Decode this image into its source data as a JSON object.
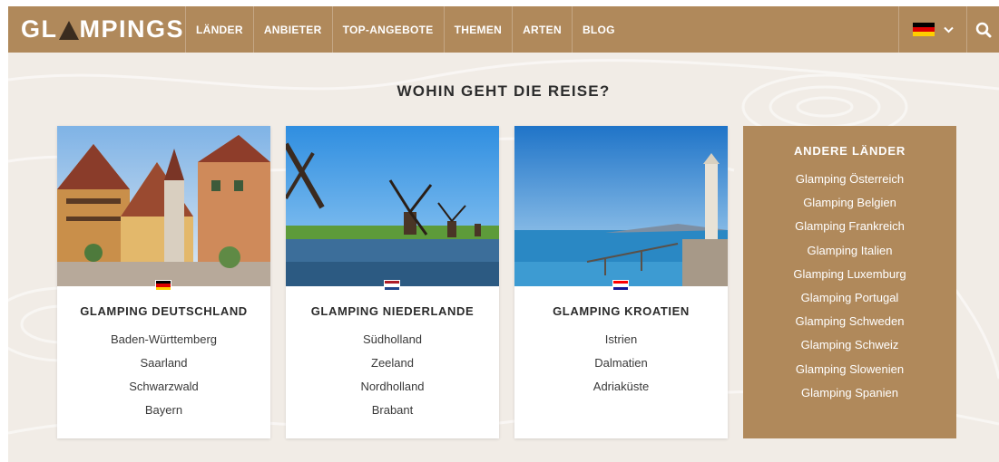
{
  "nav": {
    "logo_prefix": "GL",
    "logo_suffix": "MPINGS",
    "items": [
      "LÄNDER",
      "ANBIETER",
      "TOP-ANGEBOTE",
      "THEMEN",
      "ARTEN",
      "BLOG"
    ],
    "language_icon": "germany-flag-icon",
    "dropdown_icon": "chevron-down-icon",
    "search_icon": "search-icon"
  },
  "section_title": "WOHIN GEHT DIE REISE?",
  "cards": [
    {
      "title": "GLAMPING DEUTSCHLAND",
      "flag": "germany-flag-icon",
      "regions": [
        "Baden-Württemberg",
        "Saarland",
        "Schwarzwald",
        "Bayern"
      ]
    },
    {
      "title": "GLAMPING NIEDERLANDE",
      "flag": "netherlands-flag-icon",
      "regions": [
        "Südholland",
        "Zeeland",
        "Nordholland",
        "Brabant"
      ]
    },
    {
      "title": "GLAMPING KROATIEN",
      "flag": "croatia-flag-icon",
      "regions": [
        "Istrien",
        "Dalmatien",
        "Adriaküste"
      ]
    }
  ],
  "other_countries": {
    "title": "ANDERE LÄNDER",
    "items": [
      "Glamping Österreich",
      "Glamping Belgien",
      "Glamping Frankreich",
      "Glamping Italien",
      "Glamping Luxemburg",
      "Glamping Portugal",
      "Glamping Schweden",
      "Glamping Schweiz",
      "Glamping Slowenien",
      "Glamping Spanien"
    ]
  },
  "colors": {
    "brand": "#b0895b",
    "background": "#f1ece6",
    "text": "#2b2b2b"
  }
}
